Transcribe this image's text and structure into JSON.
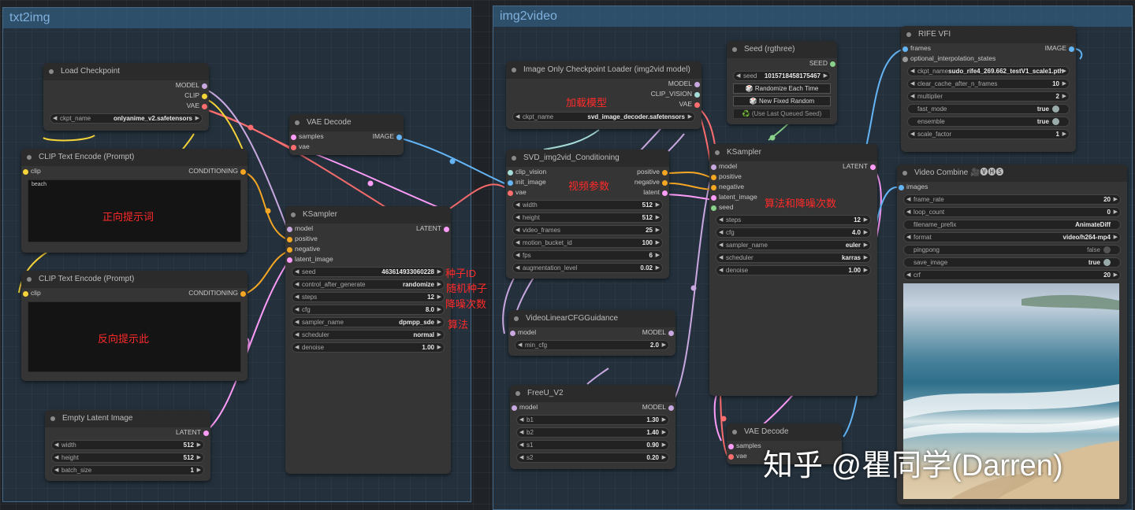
{
  "groups": {
    "left": "txt2img",
    "right": "img2video"
  },
  "nodes": {
    "load_checkpoint": {
      "title": "Load Checkpoint",
      "outputs": [
        "MODEL",
        "CLIP",
        "VAE"
      ],
      "ckpt_label": "ckpt_name",
      "ckpt_value": "onlyanime_v2.safetensors"
    },
    "clip_pos": {
      "title": "CLIP Text Encode (Prompt)",
      "input": "clip",
      "output": "CONDITIONING",
      "text": "beach"
    },
    "clip_neg": {
      "title": "CLIP Text Encode (Prompt)",
      "input": "clip",
      "output": "CONDITIONING",
      "text": ""
    },
    "empty_latent": {
      "title": "Empty Latent Image",
      "output": "LATENT",
      "widgets": [
        {
          "label": "width",
          "value": "512"
        },
        {
          "label": "height",
          "value": "512"
        },
        {
          "label": "batch_size",
          "value": "1"
        }
      ]
    },
    "vae_decode_1": {
      "title": "VAE Decode",
      "inputs": [
        "samples",
        "vae"
      ],
      "output": "IMAGE"
    },
    "ksampler_1": {
      "title": "KSampler",
      "inputs": [
        "model",
        "positive",
        "negative",
        "latent_image"
      ],
      "output": "LATENT",
      "widgets": [
        {
          "label": "seed",
          "value": "463614933060228"
        },
        {
          "label": "control_after_generate",
          "value": "randomize"
        },
        {
          "label": "steps",
          "value": "12"
        },
        {
          "label": "cfg",
          "value": "8.0"
        },
        {
          "label": "sampler_name",
          "value": "dpmpp_sde"
        },
        {
          "label": "scheduler",
          "value": "normal"
        },
        {
          "label": "denoise",
          "value": "1.00"
        }
      ]
    },
    "img_only_ckpt": {
      "title": "Image Only Checkpoint Loader (img2vid model)",
      "outputs": [
        "MODEL",
        "CLIP_VISION",
        "VAE"
      ],
      "ckpt_label": "ckpt_name",
      "ckpt_value": "svd_image_decoder.safetensors"
    },
    "svd_cond": {
      "title": "SVD_img2vid_Conditioning",
      "inputs": [
        "clip_vision",
        "init_image",
        "vae"
      ],
      "outputs": [
        "positive",
        "negative",
        "latent"
      ],
      "widgets": [
        {
          "label": "width",
          "value": "512"
        },
        {
          "label": "height",
          "value": "512"
        },
        {
          "label": "video_frames",
          "value": "25"
        },
        {
          "label": "motion_bucket_id",
          "value": "100"
        },
        {
          "label": "fps",
          "value": "6"
        },
        {
          "label": "augmentation_level",
          "value": "0.02"
        }
      ]
    },
    "video_cfg": {
      "title": "VideoLinearCFGGuidance",
      "input": "model",
      "output": "MODEL",
      "widgets": [
        {
          "label": "min_cfg",
          "value": "2.0"
        }
      ]
    },
    "freeu": {
      "title": "FreeU_V2",
      "input": "model",
      "output": "MODEL",
      "widgets": [
        {
          "label": "b1",
          "value": "1.30"
        },
        {
          "label": "b2",
          "value": "1.40"
        },
        {
          "label": "s1",
          "value": "0.90"
        },
        {
          "label": "s2",
          "value": "0.20"
        }
      ]
    },
    "seed_rgthree": {
      "title": "Seed (rgthree)",
      "output": "SEED",
      "seed_label": "seed",
      "seed_value": "1015718458175467",
      "buttons": [
        "🎲 Randomize Each Time",
        "🎲 New Fixed Random",
        "♻️ (Use Last Queued Seed)"
      ]
    },
    "ksampler_2": {
      "title": "KSampler",
      "inputs": [
        "model",
        "positive",
        "negative",
        "latent_image",
        "seed"
      ],
      "output": "LATENT",
      "widgets": [
        {
          "label": "steps",
          "value": "12"
        },
        {
          "label": "cfg",
          "value": "4.0"
        },
        {
          "label": "sampler_name",
          "value": "euler"
        },
        {
          "label": "scheduler",
          "value": "karras"
        },
        {
          "label": "denoise",
          "value": "1.00"
        }
      ]
    },
    "vae_decode_2": {
      "title": "VAE Decode",
      "inputs": [
        "samples",
        "vae"
      ]
    },
    "rife": {
      "title": "RIFE VFI",
      "inputs": [
        "frames",
        "optional_interpolation_states"
      ],
      "output": "IMAGE",
      "widgets": [
        {
          "label": "ckpt_name",
          "value": "sudo_rife4_269.662_testV1_scale1.pth"
        },
        {
          "label": "clear_cache_after_n_frames",
          "value": "10"
        },
        {
          "label": "multiplier",
          "value": "2"
        },
        {
          "label": "fast_mode",
          "value": "true"
        },
        {
          "label": "ensemble",
          "value": "true"
        },
        {
          "label": "scale_factor",
          "value": "1"
        }
      ]
    },
    "video_combine": {
      "title": "Video Combine 🎥🅥🅗🅢",
      "input": "images",
      "widgets": [
        {
          "label": "frame_rate",
          "value": "20"
        },
        {
          "label": "loop_count",
          "value": "0"
        },
        {
          "label": "filename_prefix",
          "value": "AnimateDiff"
        },
        {
          "label": "format",
          "value": "video/h264-mp4"
        },
        {
          "label": "pingpong",
          "value": "false"
        },
        {
          "label": "save_image",
          "value": "true"
        },
        {
          "label": "crf",
          "value": "20"
        }
      ]
    }
  },
  "annotations": {
    "positive_prompt": "正向提示词",
    "negative_prompt": "反向提示此",
    "seed_id": "种子ID",
    "random_seed": "随机种子",
    "denoise_steps": "降噪次数",
    "algorithm": "算法",
    "load_model": "加载模型",
    "video_params": "视频参数",
    "algo_denoise": "算法和降噪次数"
  },
  "watermark": "知乎 @瞿同学(Darren)",
  "colors": {
    "model": "#c9a8e0",
    "clip": "#f7d437",
    "vae": "#ff6e6e",
    "conditioning": "#f5a623",
    "latent": "#ff9cf9",
    "image": "#64b5f6",
    "seed": "#8ad18a",
    "clip_vision": "#a6dcd7"
  }
}
